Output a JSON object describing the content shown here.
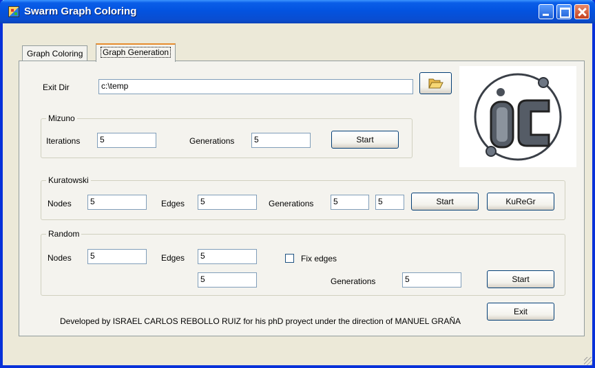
{
  "window": {
    "title": "Swarm Graph Coloring",
    "accent": "#0831d9"
  },
  "tabs": [
    {
      "label": "Graph Coloring",
      "active": false
    },
    {
      "label": "Graph Generation",
      "active": true
    }
  ],
  "exit_dir": {
    "label": "Exit Dir",
    "value": "c:\\temp",
    "browse_icon": "folder-open-icon"
  },
  "mizuno": {
    "legend": "Mizuno",
    "iterations_label": "Iterations",
    "iterations_value": "5",
    "generations_label": "Generations",
    "generations_value": "5",
    "start_label": "Start"
  },
  "kuratowski": {
    "legend": "Kuratowski",
    "nodes_label": "Nodes",
    "nodes_value": "5",
    "edges_label": "Edges",
    "edges_value": "5",
    "generations_label": "Generations",
    "generations_value_1": "5",
    "generations_value_2": "5",
    "start_label": "Start",
    "kuregr_label": "KuReGr"
  },
  "random": {
    "legend": "Random",
    "nodes_label": "Nodes",
    "nodes_value": "5",
    "edges_label": "Edges",
    "edges_value_1": "5",
    "edges_value_2": "5",
    "fix_edges_label": "Fix edges",
    "fix_edges_checked": false,
    "generations_label": "Generations",
    "generations_value": "5",
    "start_label": "Start"
  },
  "exit_label": "Exit",
  "footer": "Developed by ISRAEL CARLOS REBOLLO RUIZ for his phD proyect under the direction of MANUEL GRAÑA"
}
